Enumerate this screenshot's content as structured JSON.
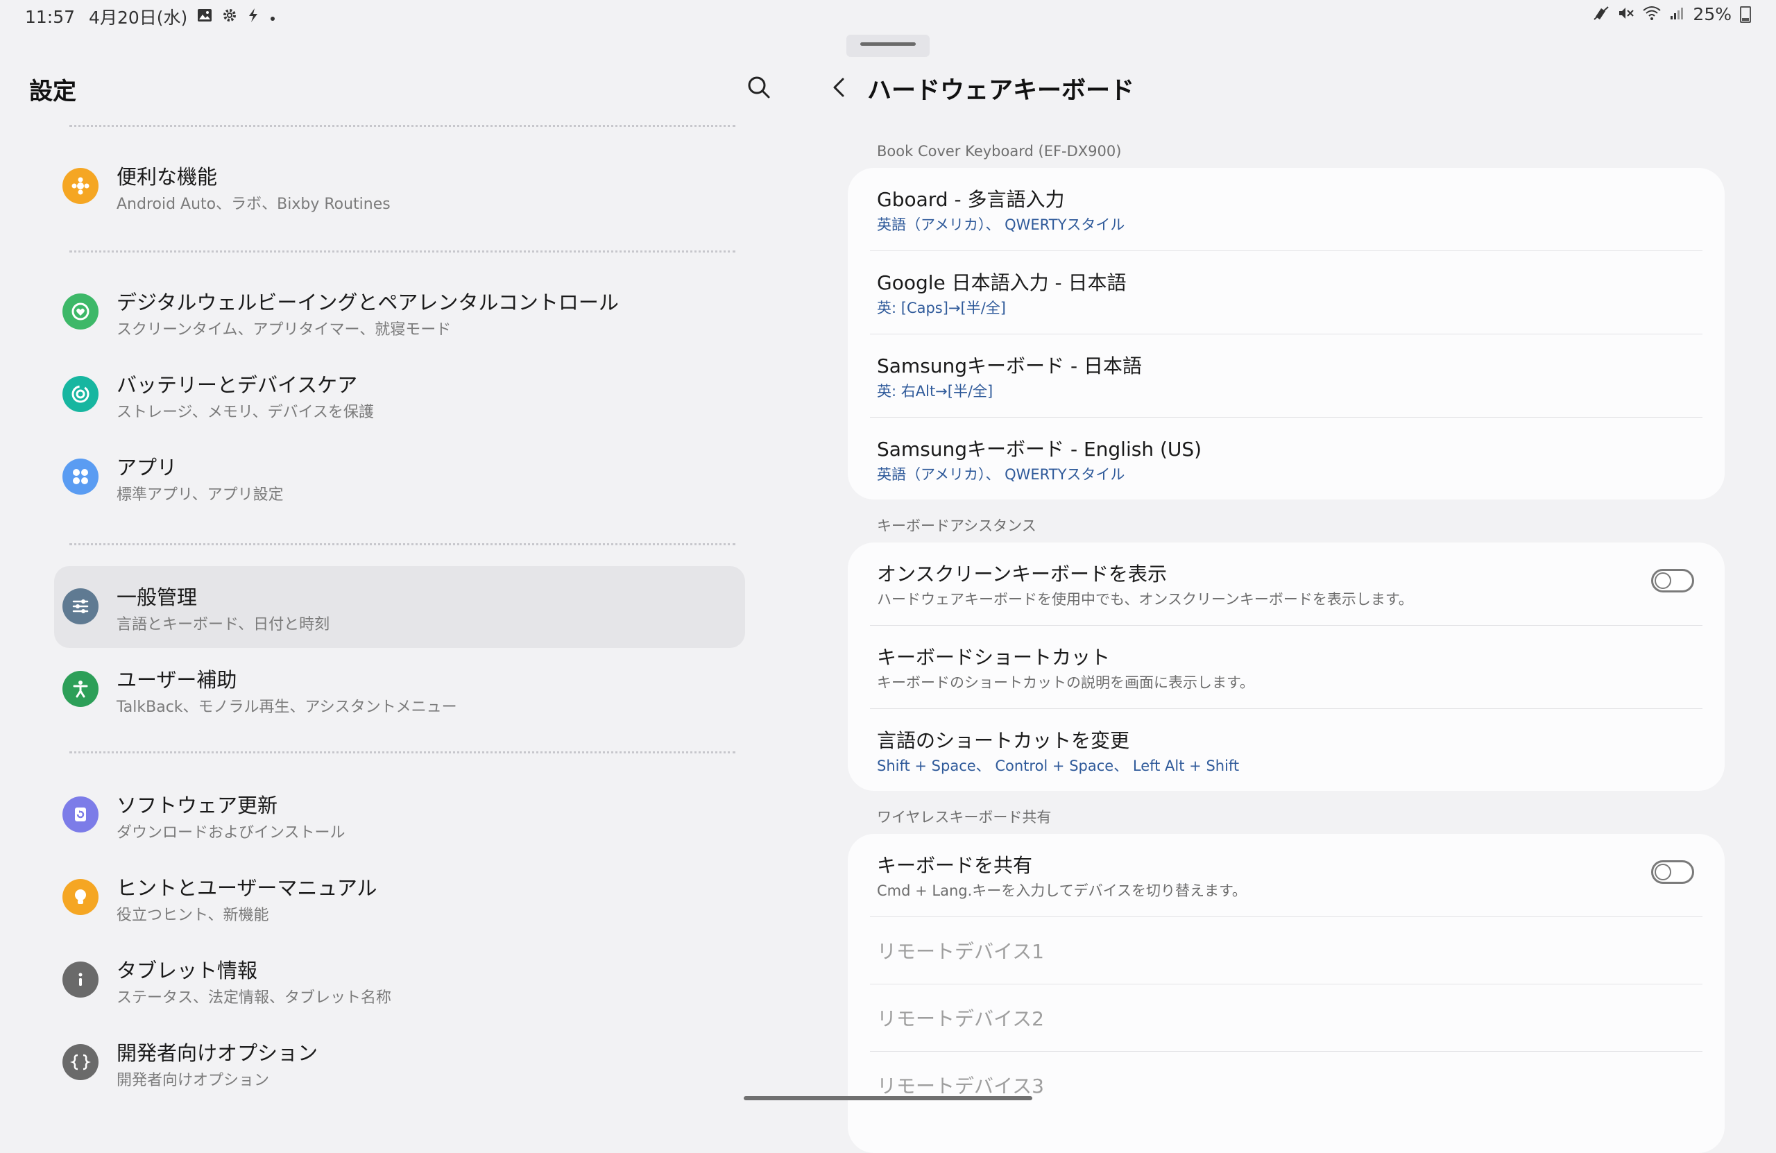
{
  "status_bar": {
    "time": "11:57",
    "date": "4月20日(水)",
    "battery": "25%",
    "left_icons": [
      "image-icon",
      "gear-icon",
      "bolt-icon",
      "dot-icon"
    ],
    "right_icons": [
      "mute-icon",
      "volume-mute-icon",
      "wifi-icon",
      "signal-icon",
      "battery-icon"
    ]
  },
  "left": {
    "title": "設定",
    "items": [
      {
        "label": "便利な機能",
        "sub": "Android Auto、ラボ、Bixby Routines",
        "icon": "star-icon",
        "color": "#f5a623"
      },
      {
        "label": "デジタルウェルビーイングとペアレンタルコントロール",
        "sub": "スクリーンタイム、アプリタイマー、就寝モード",
        "icon": "wellbeing-icon",
        "color": "#3db868"
      },
      {
        "label": "バッテリーとデバイスケア",
        "sub": "ストレージ、メモリ、デバイスを保護",
        "icon": "device-care-icon",
        "color": "#17b6a0"
      },
      {
        "label": "アプリ",
        "sub": "標準アプリ、アプリ設定",
        "icon": "apps-icon",
        "color": "#5a9cf2"
      },
      {
        "label": "一般管理",
        "sub": "言語とキーボード、日付と時刻",
        "icon": "sliders-icon",
        "color": "#5f7a92"
      },
      {
        "label": "ユーザー補助",
        "sub": "TalkBack、モノラル再生、アシスタントメニュー",
        "icon": "accessibility-icon",
        "color": "#2d9f58"
      },
      {
        "label": "ソフトウェア更新",
        "sub": "ダウンロードおよびインストール",
        "icon": "update-icon",
        "color": "#7c7ce8"
      },
      {
        "label": "ヒントとユーザーマニュアル",
        "sub": "役立つヒント、新機能",
        "icon": "lightbulb-icon",
        "color": "#f5a623"
      },
      {
        "label": "タブレット情報",
        "sub": "ステータス、法定情報、タブレット名称",
        "icon": "info-icon",
        "color": "#6a6a6a"
      },
      {
        "label": "開発者向けオプション",
        "sub": "開発者向けオプション",
        "icon": "braces-icon",
        "color": "#6a6a6a"
      }
    ]
  },
  "right": {
    "title": "ハードウェアキーボード",
    "sections": [
      {
        "header": "Book Cover Keyboard (EF-DX900)",
        "rows": [
          {
            "title": "Gboard - 多言語入力",
            "sub": "英語（アメリカ）、 QWERTYスタイル"
          },
          {
            "title": "Google 日本語入力 - 日本語",
            "sub": "英: [Caps]→[半/全]"
          },
          {
            "title": "Samsungキーボード - 日本語",
            "sub": "英: 右Alt→[半/全]"
          },
          {
            "title": "Samsungキーボード - English (US)",
            "sub": "英語（アメリカ）、 QWERTYスタイル"
          }
        ]
      },
      {
        "header": "キーボードアシスタンス",
        "rows": [
          {
            "title": "オンスクリーンキーボードを表示",
            "sub": "ハードウェアキーボードを使用中でも、オンスクリーンキーボードを表示します。",
            "toggle": false
          },
          {
            "title": "キーボードショートカット",
            "sub": "キーボードのショートカットの説明を画面に表示します。"
          },
          {
            "title": "言語のショートカットを変更",
            "sub": "Shift + Space、 Control + Space、 Left Alt + Shift"
          }
        ]
      },
      {
        "header": "ワイヤレスキーボード共有",
        "rows": [
          {
            "title": "キーボードを共有",
            "sub": "Cmd + Lang.キーを入力してデバイスを切り替えます。",
            "toggle": false
          },
          {
            "title": "リモートデバイス1"
          },
          {
            "title": "リモートデバイス2"
          },
          {
            "title": "リモートデバイス3"
          }
        ]
      }
    ]
  }
}
